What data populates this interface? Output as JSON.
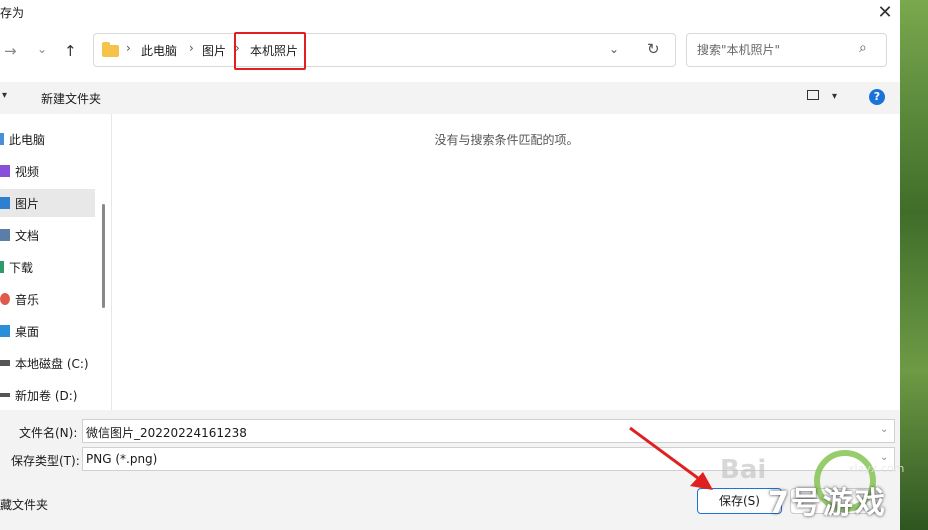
{
  "window": {
    "title": "存为",
    "close_glyph": "✕"
  },
  "nav": {
    "back_glyph": "→",
    "forward_dd_glyph": "⌄",
    "up_glyph": "↑",
    "breadcrumb": [
      "此电脑",
      "图片",
      "本机照片"
    ],
    "sep": "›",
    "addr_dd": "⌄",
    "refresh_glyph": "↻",
    "search_placeholder": "搜索\"本机照片\"",
    "search_glyph": "⌕"
  },
  "toolbar": {
    "dd_glyph": "▾",
    "new_folder": "新建文件夹",
    "view_dd_glyph": "▾",
    "help_glyph": "?"
  },
  "sidebar": {
    "items": [
      {
        "label": "此电脑",
        "color": "#4a8fd8"
      },
      {
        "label": "视频",
        "color": "#8a4fd8"
      },
      {
        "label": "图片",
        "color": "#2f7fd0"
      },
      {
        "label": "文档",
        "color": "#5a7ea8"
      },
      {
        "label": "下载",
        "color": "#2f9a6a"
      },
      {
        "label": "音乐",
        "color": "#e05a4a"
      },
      {
        "label": "桌面",
        "color": "#2a8fd8"
      },
      {
        "label": "本地磁盘 (C:)",
        "color": "#555555"
      },
      {
        "label": "新加卷 (D:)",
        "color": "#555555"
      }
    ],
    "selected_index": 2
  },
  "main": {
    "empty_message": "没有与搜索条件匹配的项。"
  },
  "form": {
    "filename_label": "文件名(N):",
    "filename_value": "微信图片_20220224161238",
    "filetype_label": "保存类型(T):",
    "filetype_value": "PNG (*.png)",
    "dd_glyph": "⌄",
    "hide_folders": "藏文件夹",
    "save_label": "保存(S)"
  },
  "overlay": {
    "watermark": "Bai",
    "logo_site": "xlayx.com",
    "logo_text": "7号游戏"
  },
  "colors": {
    "highlight_box": "#e02020",
    "arrow": "#e02020",
    "accent": "#1a73d9"
  }
}
